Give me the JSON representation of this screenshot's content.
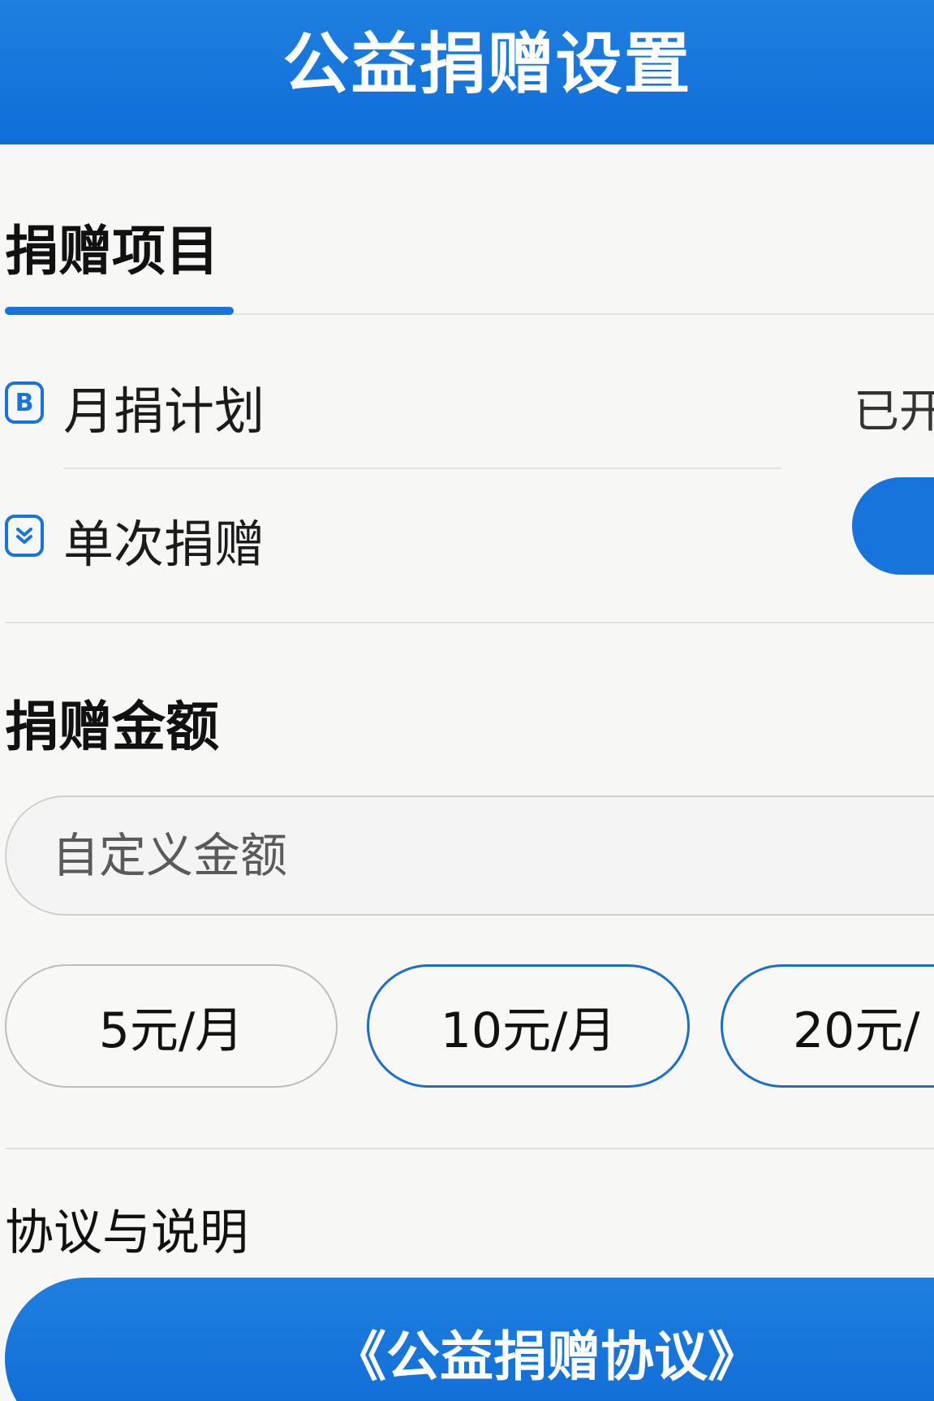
{
  "header": {
    "title": "公益捐赠设置"
  },
  "project_section": {
    "title": "捐赠项目",
    "options": [
      {
        "label": "月捐计划",
        "icon": "b-badge-icon",
        "status": "已开"
      },
      {
        "label": "单次捐赠",
        "icon": "chevron-down-badge-icon"
      }
    ],
    "toggle_on": true
  },
  "amount_section": {
    "title": "捐赠金额",
    "custom_placeholder": "自定义金额",
    "chips": [
      {
        "label": "5元/月"
      },
      {
        "label": "10元/月"
      },
      {
        "label": "20元/"
      }
    ]
  },
  "agreement_section": {
    "title": "协议与说明",
    "link_label": "《公益捐赠协议》"
  },
  "colors": {
    "accent": "#1674dc",
    "header": "#1f7fe0"
  }
}
